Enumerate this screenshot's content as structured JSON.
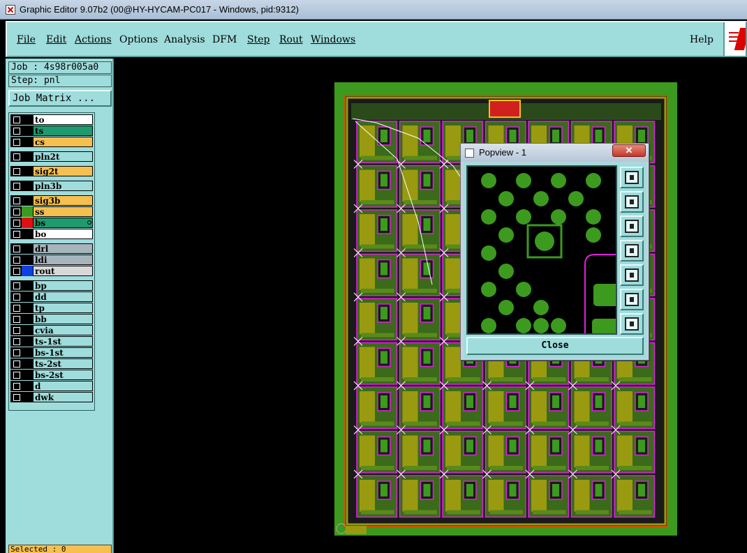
{
  "window": {
    "title": "Graphic Editor 9.07b2 (00@HY-HYCAM-PC017 - Windows, pid:9312)"
  },
  "menubar": {
    "items": [
      {
        "label": "File"
      },
      {
        "label": "Edit"
      },
      {
        "label": "Actions"
      },
      {
        "label": "Options"
      },
      {
        "label": "Analysis"
      },
      {
        "label": "DFM"
      },
      {
        "label": "Step"
      },
      {
        "label": "Rout"
      },
      {
        "label": "Windows"
      },
      {
        "label": "Help"
      }
    ]
  },
  "leftpanel": {
    "job": "Job : 4s98r005a0",
    "step": "Step: pnl",
    "job_matrix_label": "Job Matrix ...",
    "selected": "Selected : 0",
    "layers": [
      {
        "name": "to",
        "color": "#ffffff",
        "swatch": "#000000"
      },
      {
        "name": "ts",
        "color": "#1f9a6e",
        "swatch": "#000000"
      },
      {
        "name": "cs",
        "color": "#f6c050",
        "swatch": "#000000"
      },
      {
        "name": "pln2t",
        "color": "#9fdcdc",
        "swatch": "#000000"
      },
      {
        "name": "sig2t",
        "color": "#f6c050",
        "swatch": "#000000"
      },
      {
        "name": "pln3b",
        "color": "#9fdcdc",
        "swatch": "#000000"
      },
      {
        "name": "sig3b",
        "color": "#f6c050",
        "swatch": "#000000"
      },
      {
        "name": "ss",
        "color": "#f6c050",
        "swatch": "#3c9a1e"
      },
      {
        "name": "bs",
        "color": "#1f9a6e",
        "swatch": "#e01010"
      },
      {
        "name": "bo",
        "color": "#ffffff",
        "swatch": "#000000"
      },
      {
        "name": "drl",
        "color": "#a7b4bc",
        "swatch": "#000000"
      },
      {
        "name": "ldi",
        "color": "#a7b4bc",
        "swatch": "#000000"
      },
      {
        "name": "rout",
        "color": "#d8d8d8",
        "swatch": "#1040e0"
      },
      {
        "name": "bp",
        "color": "#9fdcdc",
        "swatch": "#000000"
      },
      {
        "name": "dd",
        "color": "#9fdcdc",
        "swatch": "#000000"
      },
      {
        "name": "tp",
        "color": "#9fdcdc",
        "swatch": "#000000"
      },
      {
        "name": "bb",
        "color": "#9fdcdc",
        "swatch": "#000000"
      },
      {
        "name": "cvia",
        "color": "#9fdcdc",
        "swatch": "#000000"
      },
      {
        "name": "ts-1st",
        "color": "#9fdcdc",
        "swatch": "#000000"
      },
      {
        "name": "bs-1st",
        "color": "#9fdcdc",
        "swatch": "#000000"
      },
      {
        "name": "ts-2st",
        "color": "#9fdcdc",
        "swatch": "#000000"
      },
      {
        "name": "bs-2st",
        "color": "#9fdcdc",
        "swatch": "#000000"
      },
      {
        "name": "d",
        "color": "#9fdcdc",
        "swatch": "#000000"
      },
      {
        "name": "dwk",
        "color": "#9fdcdc",
        "swatch": "#000000"
      }
    ]
  },
  "popview": {
    "title": "Popview - 1",
    "close_label": "Close",
    "tools": [
      "zoom-home-icon",
      "pan-up-icon",
      "pan-down-icon",
      "pan-left-icon",
      "pan-right-icon",
      "zoom-in-icon",
      "zoom-out-icon"
    ]
  },
  "colors": {
    "panel": "#9fdcdc",
    "board_green": "#3c9a1e",
    "magenta": "#e020e0",
    "olive": "#9a9a10"
  }
}
